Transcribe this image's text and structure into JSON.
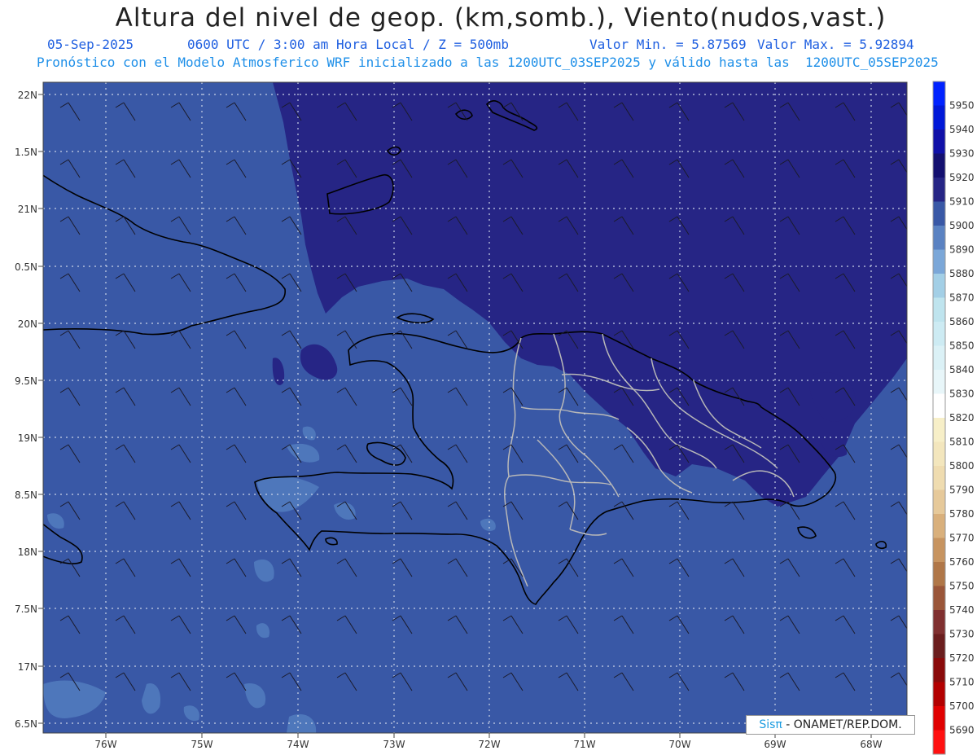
{
  "header": {
    "title": "Altura del nivel de geop. (km,somb.), Viento(nudos,vast.)",
    "date": "05-Sep-2025",
    "time": "0600 UTC / 3:00 am Hora Local / Z = 500mb",
    "min_label": "Valor Min. = 5.87569",
    "max_label": "Valor Max. = 5.92894",
    "model_line": "Pronóstico con el Modelo Atmosferico WRF inicializado a las 1200UTC_03SEP2025 y válido hasta las  1200UTC_05SEP2025"
  },
  "axes": {
    "lat_labels": [
      "22N",
      "1.5N",
      "21N",
      "0.5N",
      "20N",
      "9.5N",
      "19N",
      "8.5N",
      "18N",
      "7.5N",
      "17N",
      "6.5N"
    ],
    "lon_labels": [
      "76W",
      "75W",
      "74W",
      "73W",
      "72W",
      "71W",
      "70W",
      "69W",
      "68W"
    ]
  },
  "colorbar": {
    "labels": [
      "5950",
      "5940",
      "5930",
      "5920",
      "5910",
      "5900",
      "5890",
      "5880",
      "5870",
      "5860",
      "5850",
      "5840",
      "5830",
      "5820",
      "5810",
      "5800",
      "5790",
      "5780",
      "5770",
      "5760",
      "5750",
      "5740",
      "5730",
      "5720",
      "5710",
      "5700",
      "5690"
    ],
    "colors": [
      "#0022ff",
      "#0018d8",
      "#1010a8",
      "#141070",
      "#262585",
      "#3958a6",
      "#5a82c2",
      "#7ba7d8",
      "#a3cfe6",
      "#bfe4ee",
      "#cdebf3",
      "#dbf1f6",
      "#e8f6f9",
      "#ffffff",
      "#f7efc8",
      "#f3e6bd",
      "#efdcb0",
      "#e6c99a",
      "#d9b07c",
      "#c79460",
      "#b07748",
      "#9a5639",
      "#803030",
      "#6b1e1e",
      "#8a0a0a",
      "#b30000",
      "#e00000",
      "#ff1010"
    ],
    "accent_colors": {
      "field_main": "#3958a6",
      "field_high": "#262585",
      "field_low": "#5a82c2"
    }
  },
  "credit": {
    "logo": "Sisπ",
    "text": " - ONAMET/REP.DOM."
  }
}
